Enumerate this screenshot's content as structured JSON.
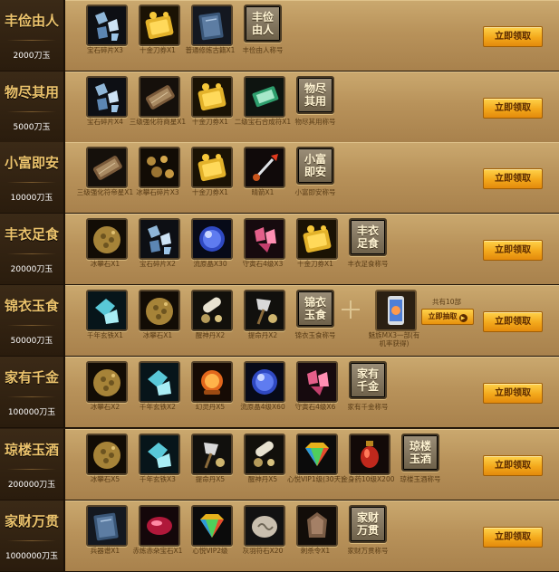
{
  "claim_label": "立即领取",
  "rows": [
    {
      "title": "丰俭由人",
      "price": "2000刀玉",
      "items": [
        {
          "name": "宝石碎片X3",
          "icon": "gem-shards-icon"
        },
        {
          "name": "十金刀券X1",
          "icon": "gold-ticket-icon"
        },
        {
          "name": "普通修炼古籍X1",
          "icon": "book-icon"
        },
        {
          "name": "丰俭由人称号",
          "icon": "title-icon",
          "title_text": "丰俭由人"
        }
      ]
    },
    {
      "title": "物尽其用",
      "price": "5000刀玉",
      "items": [
        {
          "name": "宝石碎片X4",
          "icon": "gem-shards-icon"
        },
        {
          "name": "三级强化符商星X1",
          "icon": "scroll-icon"
        },
        {
          "name": "十金刀券X1",
          "icon": "gold-ticket-icon"
        },
        {
          "name": "二级宝石合成符X1",
          "icon": "talisman-icon"
        },
        {
          "name": "物尽其用称号",
          "icon": "title-icon",
          "title_text": "物尽其用"
        }
      ]
    },
    {
      "title": "小富即安",
      "price": "10000刀玉",
      "items": [
        {
          "name": "三级强化符帝星X1",
          "icon": "scroll-icon"
        },
        {
          "name": "冰攀石碎片X3",
          "icon": "ore-shards-icon"
        },
        {
          "name": "十金刀券X1",
          "icon": "gold-ticket-icon"
        },
        {
          "name": "晴箭X1",
          "icon": "arrow-icon"
        },
        {
          "name": "小富即安称号",
          "icon": "title-icon",
          "title_text": "小富即安"
        }
      ]
    },
    {
      "title": "丰衣足食",
      "price": "20000刀玉",
      "items": [
        {
          "name": "冰攀石X1",
          "icon": "ore-icon"
        },
        {
          "name": "宝石碎片X2",
          "icon": "gem-shards-icon"
        },
        {
          "name": "流原晶X30",
          "icon": "blue-orb-icon"
        },
        {
          "name": "守寅石4级X3",
          "icon": "pink-crystal-icon"
        },
        {
          "name": "十金刀券X1",
          "icon": "gold-ticket-icon"
        },
        {
          "name": "丰衣足食称号",
          "icon": "title-icon",
          "title_text": "丰衣足食"
        }
      ]
    },
    {
      "title": "锦衣玉食",
      "price": "50000刀玉",
      "items": [
        {
          "name": "千年玄铁X1",
          "icon": "cyan-crystal-icon"
        },
        {
          "name": "冰攀石X1",
          "icon": "ore-icon"
        },
        {
          "name": "醒神丹X2",
          "icon": "pill-icon"
        },
        {
          "name": "提命丹X2",
          "icon": "axe-pill-icon"
        },
        {
          "name": "锦衣玉食称号",
          "icon": "title-icon",
          "title_text": "锦衣玉食"
        }
      ],
      "extra": {
        "count_text": "共有10部",
        "draw_label": "立即抽取",
        "phone_name": "魅族MX3一部(有机率获得)"
      }
    },
    {
      "title": "家有千金",
      "price": "100000刀玉",
      "items": [
        {
          "name": "冰攀石X2",
          "icon": "ore-icon"
        },
        {
          "name": "千年玄铁X2",
          "icon": "cyan-crystal-icon"
        },
        {
          "name": "幻灵丹X5",
          "icon": "orange-orb-icon"
        },
        {
          "name": "流原晶4级X60",
          "icon": "blue-orb-icon"
        },
        {
          "name": "守寅石4级X6",
          "icon": "pink-crystal-icon"
        },
        {
          "name": "家有千金称号",
          "icon": "title-icon",
          "title_text": "家有千金"
        }
      ]
    },
    {
      "title": "琼楼玉酒",
      "price": "200000刀玉",
      "items": [
        {
          "name": "冰攀石X5",
          "icon": "ore-icon"
        },
        {
          "name": "千年玄铁X3",
          "icon": "cyan-crystal-icon"
        },
        {
          "name": "提命丹X5",
          "icon": "axe-pill-icon"
        },
        {
          "name": "醒神丹X5",
          "icon": "pill-icon"
        },
        {
          "name": "心悦VIP1级(30天)",
          "icon": "vip-diamond-icon"
        },
        {
          "name": "金身药10级X200",
          "icon": "red-vase-icon"
        },
        {
          "name": "琼楼玉酒称号",
          "icon": "title-icon",
          "title_text": "琼楼玉酒"
        }
      ]
    },
    {
      "title": "家财万贯",
      "price": "1000000刀玉",
      "items": [
        {
          "name": "兵器谱X1",
          "icon": "book-icon"
        },
        {
          "name": "赤炼赤朵宝石X1",
          "icon": "red-gem-icon"
        },
        {
          "name": "心悦VIP2级",
          "icon": "vip-diamond-icon"
        },
        {
          "name": "灰羽符石X20",
          "icon": "stone-icon"
        },
        {
          "name": "刺杀令X1",
          "icon": "token-icon"
        },
        {
          "name": "家财万贯称号",
          "icon": "title-icon",
          "title_text": "家财万贯"
        }
      ]
    }
  ]
}
